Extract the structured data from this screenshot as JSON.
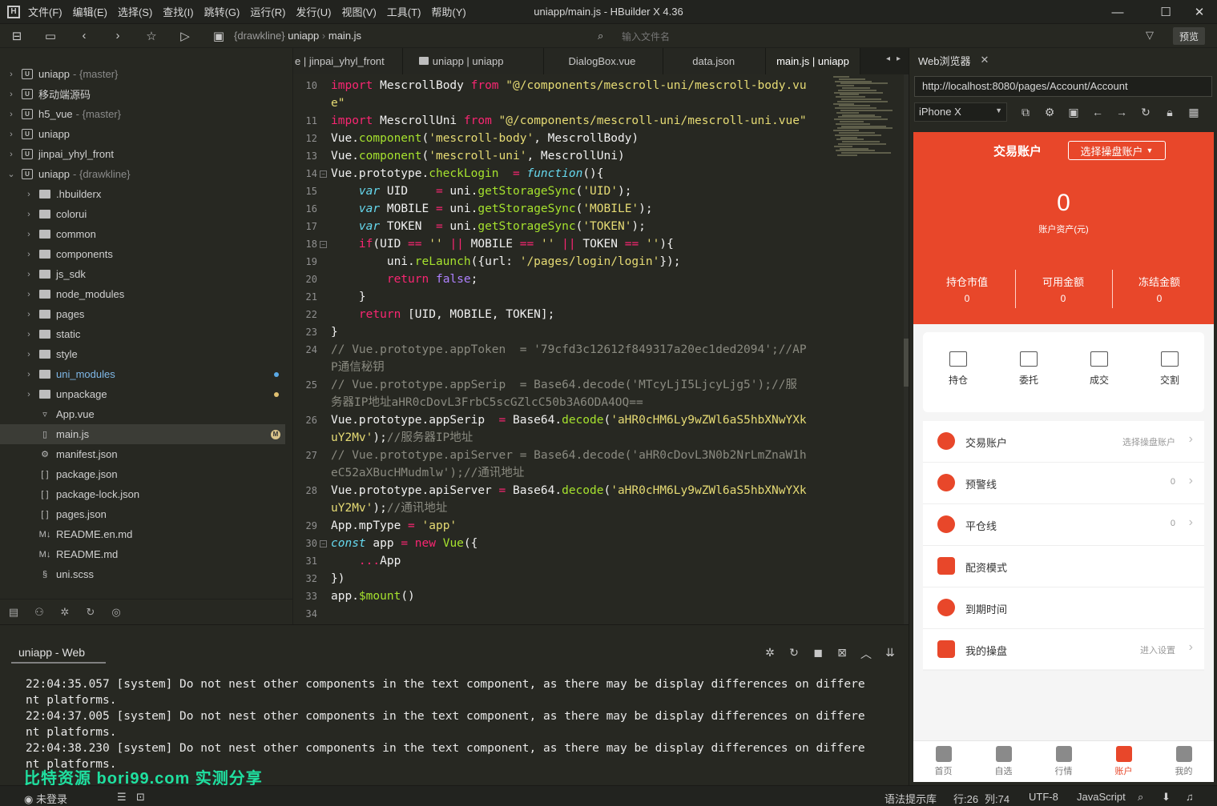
{
  "menubar": {
    "items": [
      "文件(F)",
      "编辑(E)",
      "选择(S)",
      "查找(I)",
      "跳转(G)",
      "运行(R)",
      "发行(U)",
      "视图(V)",
      "工具(T)",
      "帮助(Y)"
    ],
    "window_title": "uniapp/main.js - HBuilder X 4.36"
  },
  "toolbar": {
    "breadcrumb_branch": "{drawkline}",
    "breadcrumb_project": "uniapp",
    "breadcrumb_file": "main.js",
    "file_search_placeholder": "输入文件名",
    "preview_label": "预览"
  },
  "sidebar": {
    "rows": [
      {
        "label": "uniapp",
        "branch": "- {master}",
        "kind": "project",
        "chev": "›",
        "indent": 0
      },
      {
        "label": "移动端源码",
        "branch": "",
        "kind": "project",
        "chev": "›",
        "indent": 0
      },
      {
        "label": "h5_vue",
        "branch": "- {master}",
        "kind": "project",
        "chev": "›",
        "indent": 0
      },
      {
        "label": "uniapp",
        "branch": "",
        "kind": "project",
        "chev": "›",
        "indent": 0
      },
      {
        "label": "jinpai_yhyl_front",
        "branch": "",
        "kind": "project",
        "chev": "›",
        "indent": 0
      },
      {
        "label": "uniapp",
        "branch": "- {drawkline}",
        "kind": "project",
        "chev": "⌄",
        "indent": 0
      },
      {
        "label": ".hbuilderx",
        "branch": "",
        "kind": "folder",
        "chev": "›",
        "indent": 1
      },
      {
        "label": "colorui",
        "branch": "",
        "kind": "folder",
        "chev": "›",
        "indent": 1
      },
      {
        "label": "common",
        "branch": "",
        "kind": "folder",
        "chev": "›",
        "indent": 1
      },
      {
        "label": "components",
        "branch": "",
        "kind": "folder",
        "chev": "›",
        "indent": 1
      },
      {
        "label": "js_sdk",
        "branch": "",
        "kind": "folder",
        "chev": "›",
        "indent": 1
      },
      {
        "label": "node_modules",
        "branch": "",
        "kind": "folder",
        "chev": "›",
        "indent": 1
      },
      {
        "label": "pages",
        "branch": "",
        "kind": "folder",
        "chev": "›",
        "indent": 1
      },
      {
        "label": "static",
        "branch": "",
        "kind": "folder",
        "chev": "›",
        "indent": 1
      },
      {
        "label": "style",
        "branch": "",
        "kind": "folder",
        "chev": "›",
        "indent": 1
      },
      {
        "label": "uni_modules",
        "branch": "",
        "kind": "folder",
        "chev": "›",
        "indent": 1,
        "dot": "#5aa9e6",
        "color": "#7fb8e8"
      },
      {
        "label": "unpackage",
        "branch": "",
        "kind": "folder",
        "chev": "›",
        "indent": 1,
        "dot": "#e0c070"
      },
      {
        "label": "App.vue",
        "branch": "",
        "kind": "V",
        "chev": "",
        "indent": 1
      },
      {
        "label": "main.js",
        "branch": "",
        "kind": "file",
        "chev": "",
        "indent": 1,
        "selected": true,
        "badge": "M"
      },
      {
        "label": "manifest.json",
        "branch": "",
        "kind": "gear",
        "chev": "",
        "indent": 1
      },
      {
        "label": "package.json",
        "branch": "",
        "kind": "json",
        "chev": "",
        "indent": 1
      },
      {
        "label": "package-lock.json",
        "branch": "",
        "kind": "json",
        "chev": "",
        "indent": 1
      },
      {
        "label": "pages.json",
        "branch": "",
        "kind": "json",
        "chev": "",
        "indent": 1
      },
      {
        "label": "README.en.md",
        "branch": "",
        "kind": "md",
        "chev": "",
        "indent": 1
      },
      {
        "label": "README.md",
        "branch": "",
        "kind": "md",
        "chev": "",
        "indent": 1
      },
      {
        "label": "uni.scss",
        "branch": "",
        "kind": "scss",
        "chev": "",
        "indent": 1
      }
    ]
  },
  "editor": {
    "tabs": [
      "e | jinpai_yhyl_front",
      "uniapp | uniapp",
      "DialogBox.vue",
      "data.json",
      "main.js | uniapp"
    ],
    "active_tab": 4,
    "lines": [
      {
        "n": "10",
        "h": "<span class=\"k\">import</span> MescrollBody <span class=\"k\">from</span> <span class=\"s\">\"@/components/mescroll-uni/mescroll-body.vu</span>"
      },
      {
        "n": "",
        "h": "<span class=\"s\">e\"</span>"
      },
      {
        "n": "11",
        "h": "<span class=\"k\">import</span> MescrollUni <span class=\"k\">from</span> <span class=\"s\">\"@/components/mescroll-uni/mescroll-uni.vue\"</span>"
      },
      {
        "n": "12",
        "h": "Vue.<span class=\"f\">component</span>(<span class=\"s\">'mescroll-body'</span>, MescrollBody)"
      },
      {
        "n": "13",
        "h": "Vue.<span class=\"f\">component</span>(<span class=\"s\">'mescroll-uni'</span>, MescrollUni)"
      },
      {
        "n": "14",
        "h": "Vue.prototype.<span class=\"f\">checkLogin</span>  <span class=\"k\">=</span> <span class=\"i\">function</span>(){",
        "fold": true
      },
      {
        "n": "15",
        "h": "    <span class=\"i\">var</span> UID    <span class=\"k\">=</span> uni.<span class=\"f\">getStorageSync</span>(<span class=\"s\">'UID'</span>);"
      },
      {
        "n": "16",
        "h": "    <span class=\"i\">var</span> MOBILE <span class=\"k\">=</span> uni.<span class=\"f\">getStorageSync</span>(<span class=\"s\">'MOBILE'</span>);"
      },
      {
        "n": "17",
        "h": "    <span class=\"i\">var</span> TOKEN  <span class=\"k\">=</span> uni.<span class=\"f\">getStorageSync</span>(<span class=\"s\">'TOKEN'</span>);"
      },
      {
        "n": "18",
        "h": "    <span class=\"k\">if</span>(UID <span class=\"k\">==</span> <span class=\"s\">''</span> <span class=\"k\">||</span> MOBILE <span class=\"k\">==</span> <span class=\"s\">''</span> <span class=\"k\">||</span> TOKEN <span class=\"k\">==</span> <span class=\"s\">''</span>){",
        "fold": true
      },
      {
        "n": "19",
        "h": "        uni.<span class=\"f\">reLaunch</span>({url: <span class=\"s\">'/pages/login/login'</span>});"
      },
      {
        "n": "20",
        "h": "        <span class=\"k\">return</span> <span class=\"b\">false</span>;"
      },
      {
        "n": "21",
        "h": "    }"
      },
      {
        "n": "22",
        "h": "    <span class=\"k\">return</span> [UID, MOBILE, TOKEN];"
      },
      {
        "n": "23",
        "h": "}"
      },
      {
        "n": "24",
        "h": "<span class=\"c\">// Vue.prototype.appToken  = '79cfd3c12612f849317a20ec1ded2094';//AP</span>"
      },
      {
        "n": "",
        "h": "<span class=\"c\">P通信秘钥</span>"
      },
      {
        "n": "25",
        "h": "<span class=\"c\">// Vue.prototype.appSerip  = Base64.decode('MTcyLjI5LjcyLjg5');//服</span>"
      },
      {
        "n": "",
        "h": "<span class=\"c\">务器IP地址aHR0cDovL3FrbC5scGZlcC50b3A6ODA4OQ==</span>"
      },
      {
        "n": "26",
        "h": "Vue.prototype.appSerip  <span class=\"k\">=</span> Base64.<span class=\"f\">decode</span>(<span class=\"s\">'aHR0cHM6Ly9wZWl6aS5hbXNwYXk</span>"
      },
      {
        "n": "",
        "h": "<span class=\"s\">uY2Mv'</span>);<span class=\"c\">//服务器IP地址</span>"
      },
      {
        "n": "27",
        "h": "<span class=\"c\">// Vue.prototype.apiServer = Base64.decode('aHR0cDovL3N0b2NrLmZnaW1h</span>"
      },
      {
        "n": "",
        "h": "<span class=\"c\">eC52aXBucHMudmlw');//通讯地址</span>"
      },
      {
        "n": "28",
        "h": "Vue.prototype.apiServer <span class=\"k\">=</span> Base64.<span class=\"f\">decode</span>(<span class=\"s\">'aHR0cHM6Ly9wZWl6aS5hbXNwYXk</span>"
      },
      {
        "n": "",
        "h": "<span class=\"s\">uY2Mv'</span>);<span class=\"c\">//通讯地址</span>"
      },
      {
        "n": "29",
        "h": "App.mpType <span class=\"k\">=</span> <span class=\"s\">'app'</span>"
      },
      {
        "n": "30",
        "h": "<span class=\"i\">const</span> app <span class=\"k\">=</span> <span class=\"k\">new</span> <span class=\"f\">Vue</span>({",
        "fold": true
      },
      {
        "n": "31",
        "h": "    <span class=\"k\">...</span>App"
      },
      {
        "n": "32",
        "h": "})"
      },
      {
        "n": "33",
        "h": "app.<span class=\"f\">$mount</span>()"
      },
      {
        "n": "34",
        "h": ""
      }
    ]
  },
  "console": {
    "tab_label": "uniapp - Web",
    "lines": [
      "22:04:35.057 [system] Do not nest other components in the text component, as there may be display differences on differe",
      "nt platforms.",
      "22:04:37.005 [system] Do not nest other components in the text component, as there may be display differences on differe",
      "nt platforms.",
      "22:04:38.230 [system] Do not nest other components in the text component, as there may be display differences on differe",
      "nt platforms."
    ],
    "watermark": "比特资源 bori99.com 实测分享"
  },
  "statusbar": {
    "login": "未登录",
    "syntax_lib": "语法提示库",
    "position_row": "行:26",
    "position_col": "列:74",
    "encoding": "UTF-8",
    "language": "JavaScript"
  },
  "browser": {
    "tab_label": "Web浏览器",
    "url": "http://localhost:8080/pages/Account/Account",
    "device": "iPhone X"
  },
  "phone": {
    "title": "交易账户",
    "account_select": "选择操盘账户",
    "total_value": "0",
    "total_label": "账户资产(元)",
    "stats": [
      {
        "label": "持仓市值",
        "value": "0"
      },
      {
        "label": "可用金额",
        "value": "0"
      },
      {
        "label": "冻结金额",
        "value": "0"
      }
    ],
    "quick": [
      "持仓",
      "委托",
      "成交",
      "交割"
    ],
    "menu": [
      {
        "label": "交易账户",
        "right": "选择操盘账户"
      },
      {
        "label": "预警线",
        "right": "0"
      },
      {
        "label": "平仓线",
        "right": "0"
      },
      {
        "label": "配资模式",
        "right": ""
      },
      {
        "label": "到期时间",
        "right": ""
      },
      {
        "label": "我的操盘",
        "right": "进入设置"
      }
    ],
    "tabbar": [
      "首页",
      "自选",
      "行情",
      "账户",
      "我的"
    ],
    "active_tab": 3,
    "accent": "#e8472a"
  }
}
